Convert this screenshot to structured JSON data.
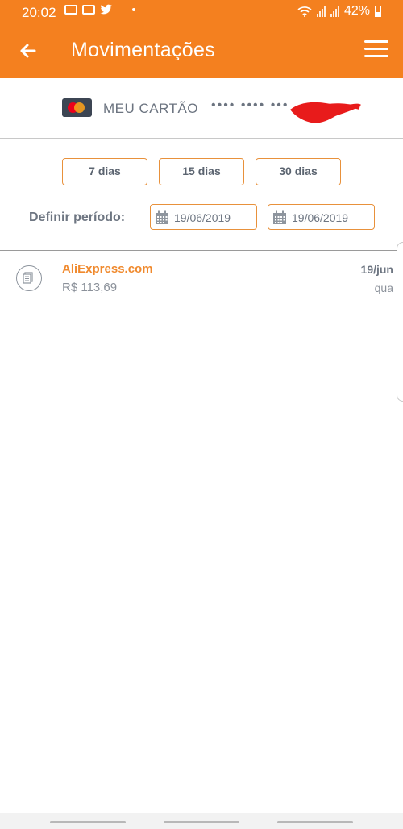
{
  "status_bar": {
    "time": "20:02",
    "battery": "42%",
    "notification_icons": [
      "message-icon",
      "message-icon",
      "twitter-icon"
    ]
  },
  "app_bar": {
    "title": "Movimentações",
    "background_color": "#f4801f"
  },
  "card": {
    "label": "MEU CARTÃO",
    "masked_number": "•••• •••• •••",
    "brand_icon": "mastercard-icon"
  },
  "filters": {
    "buttons": [
      {
        "label": "7 dias"
      },
      {
        "label": "15 dias"
      },
      {
        "label": "30 dias"
      }
    ],
    "period_label": "Definir período:",
    "start_date": "19/06/2019",
    "end_date": "19/06/2019"
  },
  "transactions": [
    {
      "merchant": "AliExpress.com",
      "amount": "R$ 113,69",
      "date": "19/jun",
      "weekday": "qua",
      "icon": "receipt-icon"
    }
  ],
  "colors": {
    "accent": "#f4801f",
    "border_orange": "#e8913b",
    "merchant_orange": "#f08a2e"
  }
}
